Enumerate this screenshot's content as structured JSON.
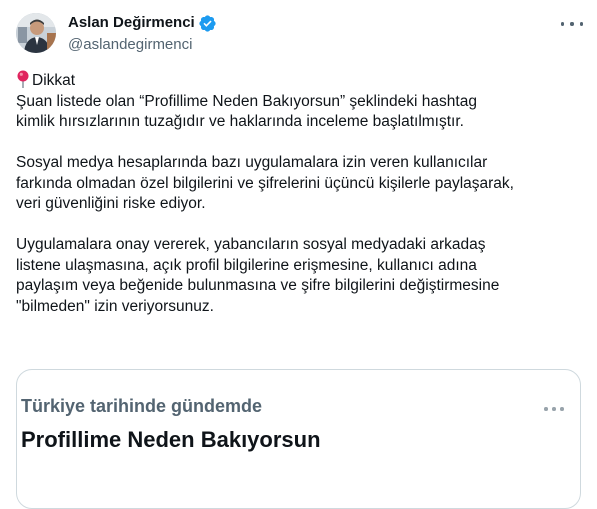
{
  "author": {
    "name": "Aslan Değirmenci",
    "handle": "@aslandegirmenci",
    "verified_color": "#1d9bf0"
  },
  "menu": {
    "icon": "more-horizontal-icon"
  },
  "tweet": {
    "heading_icon": "round-pushpin-icon",
    "heading": "Dikkat",
    "paragraphs": [
      [
        "Şuan listede olan “Profillime Neden Bakıyorsun” şeklindeki hashtag",
        "kimlik hırsızlarının tuzağıdır ve haklarında inceleme başlatılmıştır."
      ],
      [
        "Sosyal medya hesaplarında bazı uygulamalara izin veren kullanıcılar",
        "farkında olmadan özel bilgilerini ve şifrelerini üçüncü kişilerle paylaşarak,",
        "veri güvenliğini riske ediyor."
      ],
      [
        "Uygulamalara onay vererek, yabancıların sosyal medyadaki arkadaş",
        "listene ulaşmasına, açık profil bilgilerine erişmesine, kullanıcı adına",
        "paylaşım veya beğenide bulunmasına ve şifre bilgilerini değiştirmesine",
        "\"bilmeden\" izin veriyorsunuz."
      ]
    ]
  },
  "card": {
    "subtitle": "Türkiye tarihinde gündemde",
    "title": "Profillime Neden Bakıyorsun",
    "more_icon": "more-horizontal-icon"
  }
}
